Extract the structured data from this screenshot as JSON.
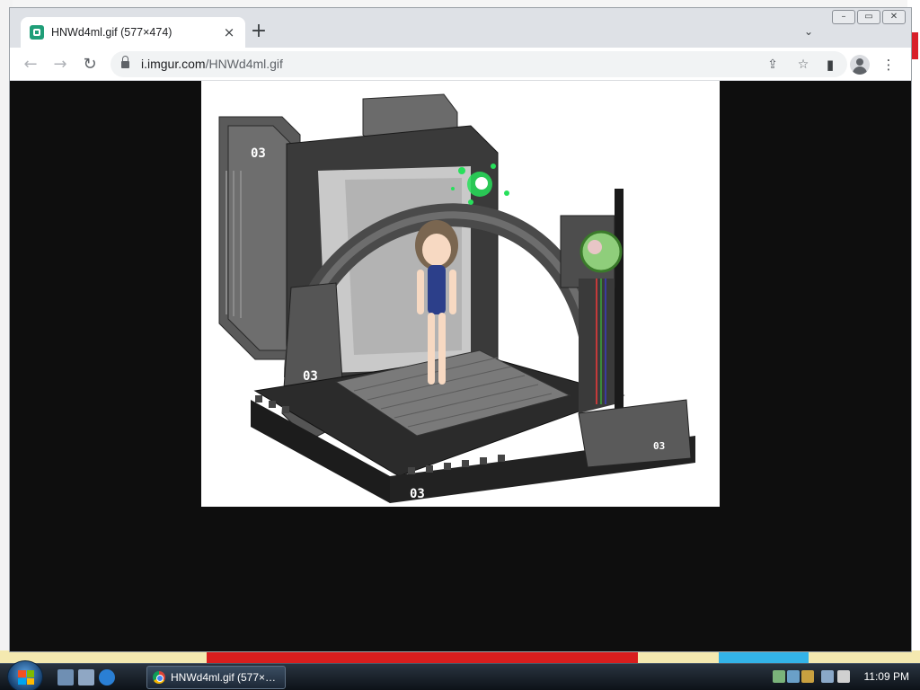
{
  "browser": {
    "tab": {
      "title": "HNWd4ml.gif (577×474)",
      "close_icon": "×"
    },
    "new_tab_icon": "+",
    "tab_search_icon": "⌄",
    "window_buttons": [
      "–",
      "▭",
      "✕"
    ],
    "nav": {
      "back_icon": "←",
      "forward_icon": "→",
      "reload_icon": "↻"
    },
    "address": {
      "domain": "i.imgur.com",
      "path": "/HNWd4ml.gif"
    },
    "toolbar_icons": {
      "share": "⇪",
      "bookmark": "☆",
      "side_panel": "▮"
    }
  },
  "image": {
    "labels": [
      "03",
      "03",
      "03",
      "03"
    ]
  },
  "taskbar": {
    "task_item": "HNWd4ml.gif (577×…",
    "clock": "11:09 PM"
  },
  "colors": {
    "viewport_bg": "#0e0e0e",
    "tab_strip": "#dee1e6",
    "favicon": "#1f9e78"
  }
}
